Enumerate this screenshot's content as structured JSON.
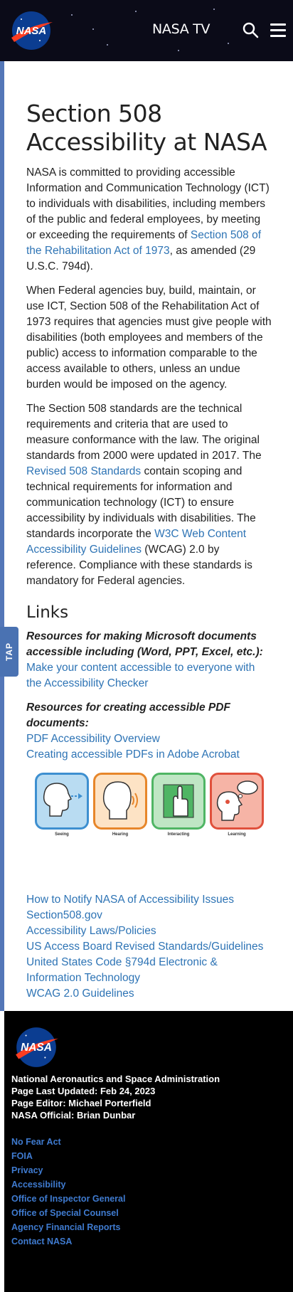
{
  "header": {
    "logo_text": "NASA",
    "tv_label": "NASA TV"
  },
  "tap_tab": "TAP",
  "main": {
    "title": "Section 508 Accessibility at NASA",
    "p1": {
      "text_before": "NASA is committed to providing accessible Information and Communication Technology (ICT) to individuals with disabilities, including members of the public and federal employees, by meeting or exceeding the requirements of ",
      "link": "Section 508 of the Rehabilitation Act of 1973",
      "text_after": ", as amended (29 U.S.C. 794d)."
    },
    "p2": "When Federal agencies buy, build, maintain, or use ICT, Section 508 of the Rehabilitation Act of 1973 requires that agencies must give people with disabilities (both employees and members of the public) access to information comparable to the access available to others, unless an undue burden would be imposed on the agency.",
    "p3": {
      "text_before": "The Section 508 standards are the technical requirements and criteria that are used to measure conformance with the law. The original standards from 2000 were updated in 2017. The ",
      "link1": "Revised 508 Standards",
      "text_mid": " contain scoping and technical requirements for information and communication technology (ICT) to ensure accessibility by individuals with disabilities. The standards incorporate the ",
      "link2": "W3C Web Content Accessibility Guidelines",
      "text_after": " (WCAG) 2.0 by reference. Compliance with these standards is mandatory for Federal agencies."
    },
    "links_heading": "Links",
    "resources_ms": {
      "heading": "Resources for making Microsoft documents accessible including (Word, PPT, Excel, etc.):",
      "link": "Make your content accessible to everyone with the Accessibility Checker"
    },
    "resources_pdf": {
      "heading": "Resources for creating accessible PDF documents:",
      "links": [
        "PDF Accessibility Overview",
        "Creating accessible PDFs in Adobe Acrobat"
      ]
    },
    "accessibility_tiles": [
      {
        "caption": "Seeing",
        "color": "#3d8fd0",
        "fill": "#b9dcf2"
      },
      {
        "caption": "Hearing",
        "color": "#e7862a",
        "fill": "#fde3c5"
      },
      {
        "caption": "Interacting",
        "color": "#4fb564",
        "fill": "#bfe6c4"
      },
      {
        "caption": "Learning",
        "color": "#e0503c",
        "fill": "#f6b4a6"
      }
    ],
    "bottom_links": [
      "How to Notify NASA of Accessibility Issues",
      "Section508.gov",
      "Accessibility Laws/Policies",
      "US Access Board Revised Standards/Guidelines",
      "United States Code §794d Electronic & Information Technology",
      "WCAG 2.0 Guidelines"
    ]
  },
  "footer": {
    "logo_text": "NASA",
    "org": "National Aeronautics and Space Administration",
    "updated": "Page Last Updated: Feb 24, 2023",
    "editor": "Page Editor: Michael Porterfield",
    "official": "NASA Official: Brian Dunbar",
    "links": [
      "No Fear Act",
      "FOIA",
      "Privacy",
      "Accessibility",
      "Office of Inspector General",
      "Office of Special Counsel",
      "Agency Financial Reports",
      "Contact NASA"
    ]
  }
}
